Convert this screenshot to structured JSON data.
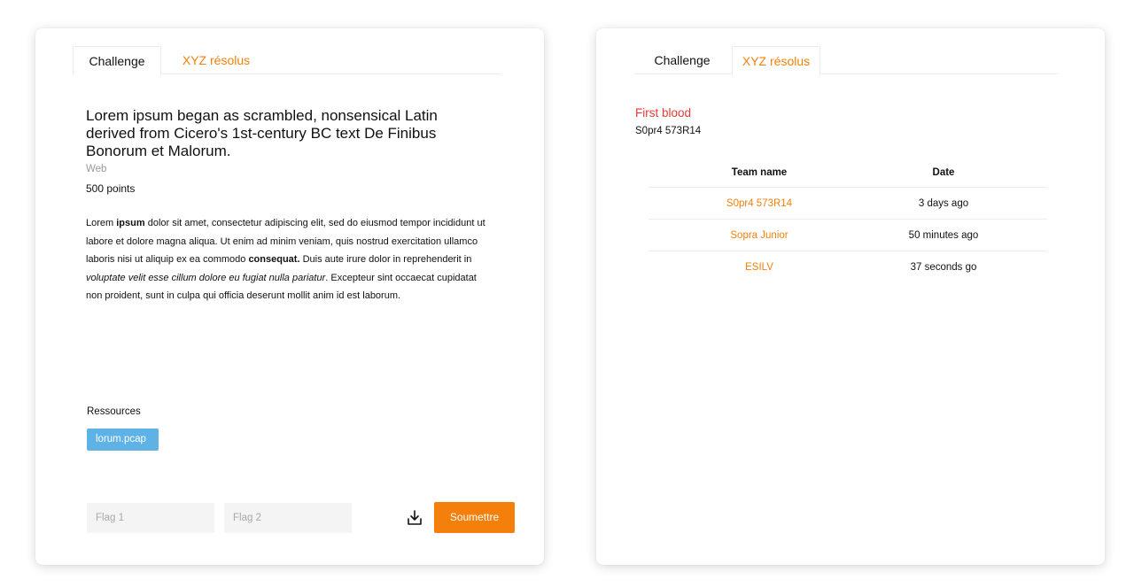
{
  "tabs": {
    "challenge": "Challenge",
    "solved": "XYZ résolus"
  },
  "challenge": {
    "title": "Lorem ipsum began as scrambled, nonsensical Latin derived from Cicero's 1st-century BC text De Finibus Bonorum et Malorum.",
    "category": "Web",
    "points": "500 points",
    "description": {
      "p1": "Lorem ",
      "p2": "ipsum",
      "p3": " dolor sit amet, consectetur adipiscing elit, sed do eiusmod tempor incididunt ut labore et dolore magna aliqua. Ut enim ad minim veniam, quis nostrud exercitation ullamco laboris nisi ut aliquip ex ea commodo ",
      "p4": "consequat.",
      "p5": " Duis aute irure dolor in reprehenderit in ",
      "p6": "voluptate velit esse cillum dolore eu fugiat nulla pariatur",
      "p7": ". Excepteur sint occaecat cupidatat non proident, sunt in culpa qui officia deserunt mollit anim id est laborum."
    },
    "resources_label": "Ressources",
    "resources": [
      "lorum.pcap"
    ]
  },
  "form": {
    "flag1_placeholder": "Flag 1",
    "flag2_placeholder": "Flag 2",
    "submit_label": "Soumettre"
  },
  "solves": {
    "first_blood_label": "First blood",
    "first_blood_team": "S0pr4 573R14",
    "headers": {
      "team": "Team name",
      "date": "Date"
    },
    "rows": [
      {
        "team": "S0pr4 573R14",
        "date": "3 days ago"
      },
      {
        "team": "Sopra Junior",
        "date": "50 minutes ago"
      },
      {
        "team": "ESILV",
        "date": "37 seconds go"
      }
    ]
  },
  "colors": {
    "accent": "#f47f0a",
    "first_blood": "#e53935",
    "resource_chip": "#5fb2e6"
  },
  "icons": {
    "download": "download-icon"
  }
}
